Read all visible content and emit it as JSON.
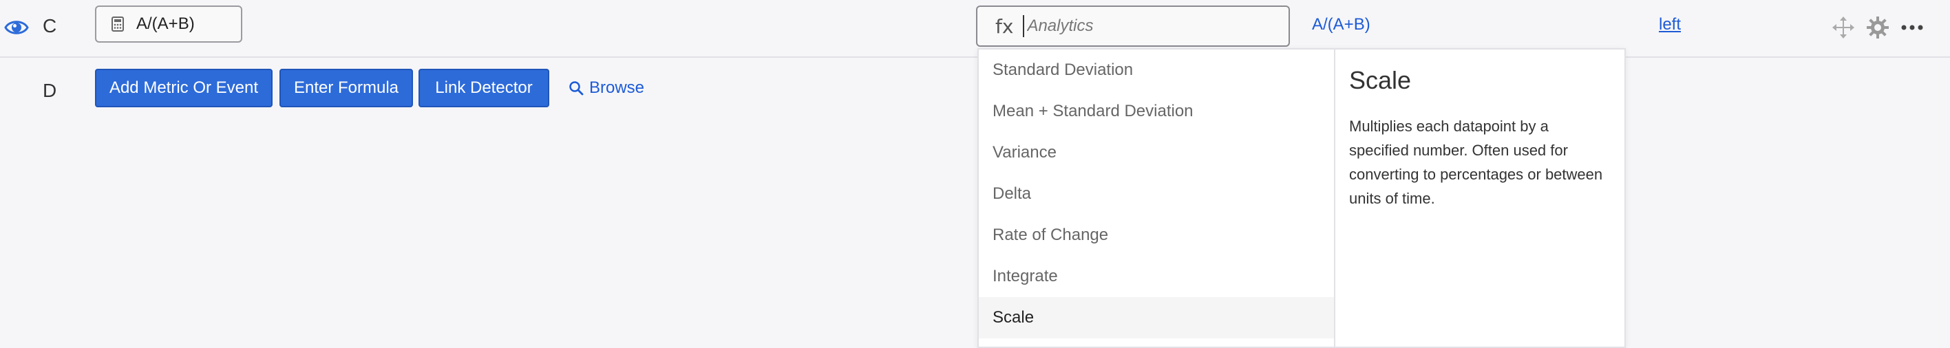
{
  "row_c": {
    "letter": "C",
    "formula_value": "A/(A+B)",
    "analytics_placeholder": "Analytics",
    "fx_label": "fx",
    "formula_link": "A/(A+B)",
    "axis_link": "left"
  },
  "row_d": {
    "letter": "D",
    "buttons": {
      "add_metric": "Add Metric Or Event",
      "enter_formula": "Enter Formula",
      "link_detector": "Link Detector"
    },
    "browse_label": "Browse"
  },
  "dropdown": {
    "options": [
      "Standard Deviation",
      "Mean + Standard Deviation",
      "Variance",
      "Delta",
      "Rate of Change",
      "Integrate",
      "Scale"
    ],
    "selected": "Scale",
    "detail": {
      "title": "Scale",
      "description": "Multiplies each datapoint by a specified number. Often used for converting to percentages or between units of time."
    }
  },
  "icons": {
    "visibility": "eye-icon",
    "calculator": "calculator-icon",
    "move": "move-icon",
    "settings": "gear-icon",
    "more": "more-icon",
    "search": "search-icon"
  },
  "colors": {
    "accent": "#2d6bd9",
    "link": "#1d5bd6",
    "background": "#f6f6f8"
  }
}
